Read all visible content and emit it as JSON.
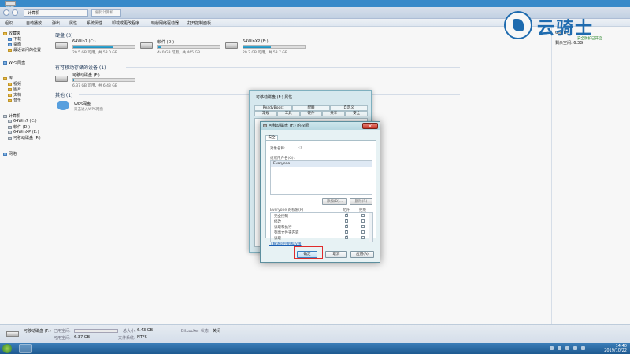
{
  "desktop": {
    "icon_label": "繁夜"
  },
  "explorer": {
    "address": "计算机",
    "search_placeholder": "搜索 计算机",
    "menu": [
      "组织",
      "自动播放",
      "弹出",
      "属性",
      "系统属性",
      "卸载或更改程序",
      "映射网络驱动器",
      "打开控制面板"
    ],
    "sidebar": {
      "items": [
        {
          "label": "收藏夹",
          "type": "header"
        },
        {
          "label": "下载",
          "type": "sub"
        },
        {
          "label": "桌面",
          "type": "sub"
        },
        {
          "label": "最近访问的位置",
          "type": "sub"
        },
        {
          "label": "WPS网盘",
          "type": "header"
        },
        {
          "label": "库",
          "type": "header"
        },
        {
          "label": "视频",
          "type": "sub"
        },
        {
          "label": "图片",
          "type": "sub"
        },
        {
          "label": "文档",
          "type": "sub"
        },
        {
          "label": "音乐",
          "type": "sub"
        },
        {
          "label": "计算机",
          "type": "header"
        },
        {
          "label": "64Win7 (C:)",
          "type": "sub"
        },
        {
          "label": "软件 (D:)",
          "type": "sub"
        },
        {
          "label": "64WinXP (E:)",
          "type": "sub"
        },
        {
          "label": "可移动磁盘 (F:)",
          "type": "sub"
        },
        {
          "label": "网络",
          "type": "header"
        }
      ]
    },
    "groups": {
      "hdd": "硬盘 (3)",
      "removable": "有可移动存储的设备 (1)",
      "other": "其他 (1)"
    },
    "drives": [
      {
        "name": "64Win7 (C:)",
        "size": "20.5 GB 可用，共 58.0 GB",
        "used": 0.65
      },
      {
        "name": "软件 (D:)",
        "size": "440 GB 可用，共 465 GB",
        "used": 0.05
      },
      {
        "name": "64WinXP (E:)",
        "size": "29.2 GB 可用，共 53.7 GB",
        "used": 0.45
      },
      {
        "name": "可移动磁盘 (F:)",
        "size": "6.37 GB 可用，共 6.43 GB",
        "used": 0.01
      }
    ],
    "wps": {
      "name": "WPS网盘",
      "desc": "双击进入WPS网盘"
    },
    "right_pane": {
      "drive": "U盘(F:)",
      "safe": "安全防护已开启",
      "free": "剩余空间: 6.3G"
    },
    "status": {
      "drive_name": "可移动磁盘 (F:)",
      "used_label": "已用空间:",
      "free_label": "可用空间:",
      "free_value": "6.37 GB",
      "total_label": "总大小:",
      "total_value": "6.43 GB",
      "fs_label": "文件系统:",
      "fs_value": "NTFS",
      "bitlocker_label": "BitLocker 状态:",
      "bitlocker_value": "关闭"
    }
  },
  "props_dialog": {
    "title": "可移动磁盘 (F:) 属性",
    "tabs_row1": [
      "ReadyBoost",
      "配额",
      "自定义"
    ],
    "tabs_row2": [
      "常规",
      "工具",
      "硬件",
      "共享",
      "安全"
    ]
  },
  "perm_dialog": {
    "title": "可移动磁盘 (F:) 的权限",
    "tab": "安全",
    "object_label": "对象名称:",
    "object_value": "F:\\",
    "group_label": "组或用户名(G):",
    "user": "Everyone",
    "add_button": "添加(D)...",
    "remove_button": "删除(R)",
    "perm_label": "Everyone 的权限(P)",
    "allow": "允许",
    "deny": "拒绝",
    "permissions": [
      {
        "name": "完全控制",
        "allow": true,
        "deny": false
      },
      {
        "name": "修改",
        "allow": true,
        "deny": false
      },
      {
        "name": "读取和执行",
        "allow": true,
        "deny": false
      },
      {
        "name": "列出文件夹内容",
        "allow": true,
        "deny": false
      },
      {
        "name": "读取",
        "allow": true,
        "deny": false
      }
    ],
    "link": "了解访问控制和权限",
    "ok": "确定",
    "cancel": "取消",
    "apply": "应用(A)"
  },
  "watermark": {
    "text": "云骑士"
  },
  "taskbar": {
    "time": "14:40",
    "date": "2019/10/22"
  }
}
